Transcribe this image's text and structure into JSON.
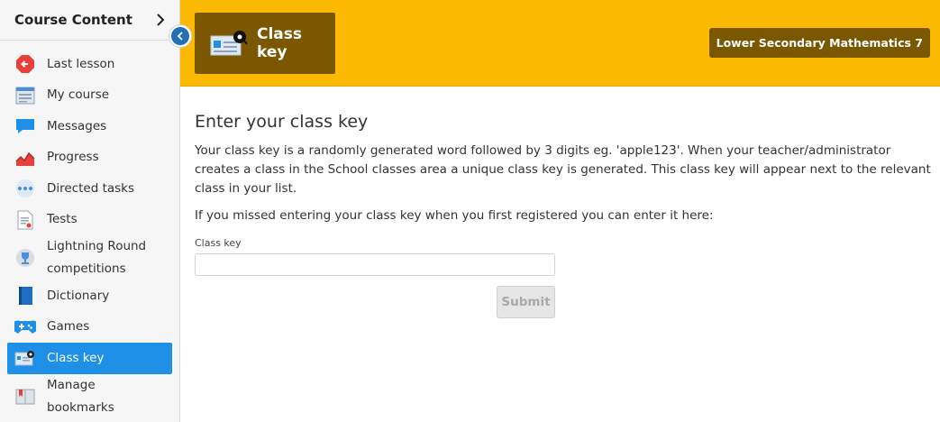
{
  "sidebar": {
    "title": "Course Content",
    "items": [
      {
        "label": "Last lesson",
        "icon": "back-arrow-icon"
      },
      {
        "label": "My course",
        "icon": "course-page-icon"
      },
      {
        "label": "Messages",
        "icon": "speech-bubble-icon"
      },
      {
        "label": "Progress",
        "icon": "progress-chart-icon"
      },
      {
        "label": "Directed tasks",
        "icon": "directed-tasks-icon"
      },
      {
        "label": "Tests",
        "icon": "test-document-icon"
      },
      {
        "label": "Lightning Round competitions",
        "icon": "trophy-icon"
      },
      {
        "label": "Dictionary",
        "icon": "book-icon"
      },
      {
        "label": "Games",
        "icon": "gamepad-icon"
      },
      {
        "label": "Class key",
        "icon": "class-key-icon",
        "active": true
      },
      {
        "label": "Manage bookmarks",
        "icon": "bookmark-book-icon"
      }
    ]
  },
  "header": {
    "title": "Class key",
    "course": "Lower Secondary Mathematics 7"
  },
  "main": {
    "heading": "Enter your class key",
    "description": "Your class key is a randomly generated word followed by 3 digits eg. 'apple123'. When your teacher/administrator creates a class in the School classes area a unique class key is generated. This class key will appear next to the relevant class in your list.",
    "hint": "If you missed entering your class key when you first registered you can enter it here:",
    "field_label": "Class key",
    "field_value": "",
    "submit_label": "Submit"
  },
  "colors": {
    "header_bg": "#fbb901",
    "header_box": "#7b5702",
    "active_item": "#1e90e8",
    "collapse_button": "#2470b8"
  }
}
